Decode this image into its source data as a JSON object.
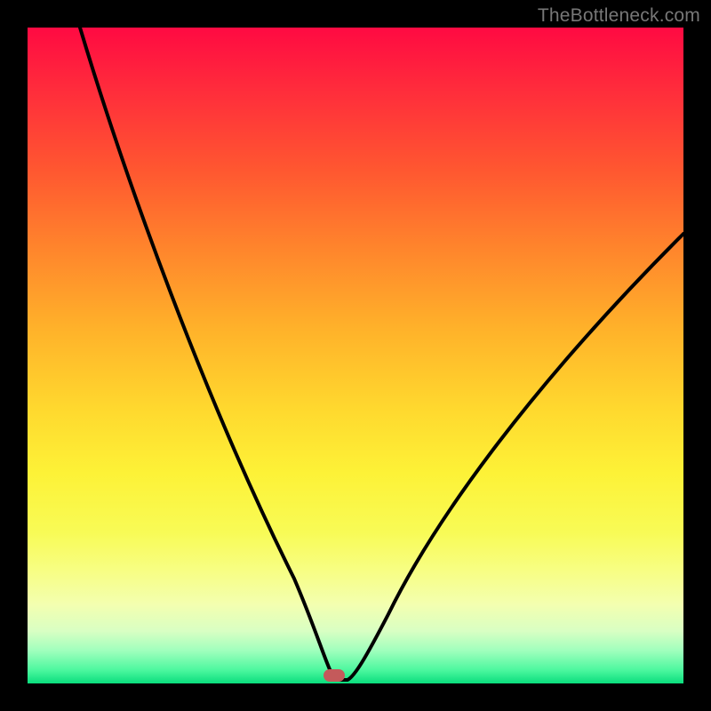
{
  "watermark": "TheBottleneck.com",
  "chart_data": {
    "type": "line",
    "title": "",
    "xlabel": "",
    "ylabel": "",
    "xlim": [
      0,
      100
    ],
    "ylim": [
      0,
      100
    ],
    "series": [
      {
        "name": "curve",
        "x": [
          8,
          12,
          18,
          24,
          30,
          36,
          40,
          43,
          45,
          46.5,
          47.5,
          48.5,
          50,
          52,
          55,
          60,
          66,
          74,
          82,
          90,
          100
        ],
        "y": [
          100,
          88,
          73,
          59,
          45,
          31,
          20,
          12,
          6,
          2,
          0.5,
          0.5,
          1.5,
          4,
          9,
          18,
          28,
          40,
          50,
          59,
          68
        ]
      }
    ],
    "marker": {
      "x_pct": 47,
      "y_pct": 0.5,
      "color": "#c45a5b"
    },
    "gradient_stops": [
      {
        "pos": 0.0,
        "color": "#ff0a42"
      },
      {
        "pos": 0.5,
        "color": "#ffd82e"
      },
      {
        "pos": 0.85,
        "color": "#f7fe85"
      },
      {
        "pos": 1.0,
        "color": "#0add7d"
      }
    ]
  }
}
